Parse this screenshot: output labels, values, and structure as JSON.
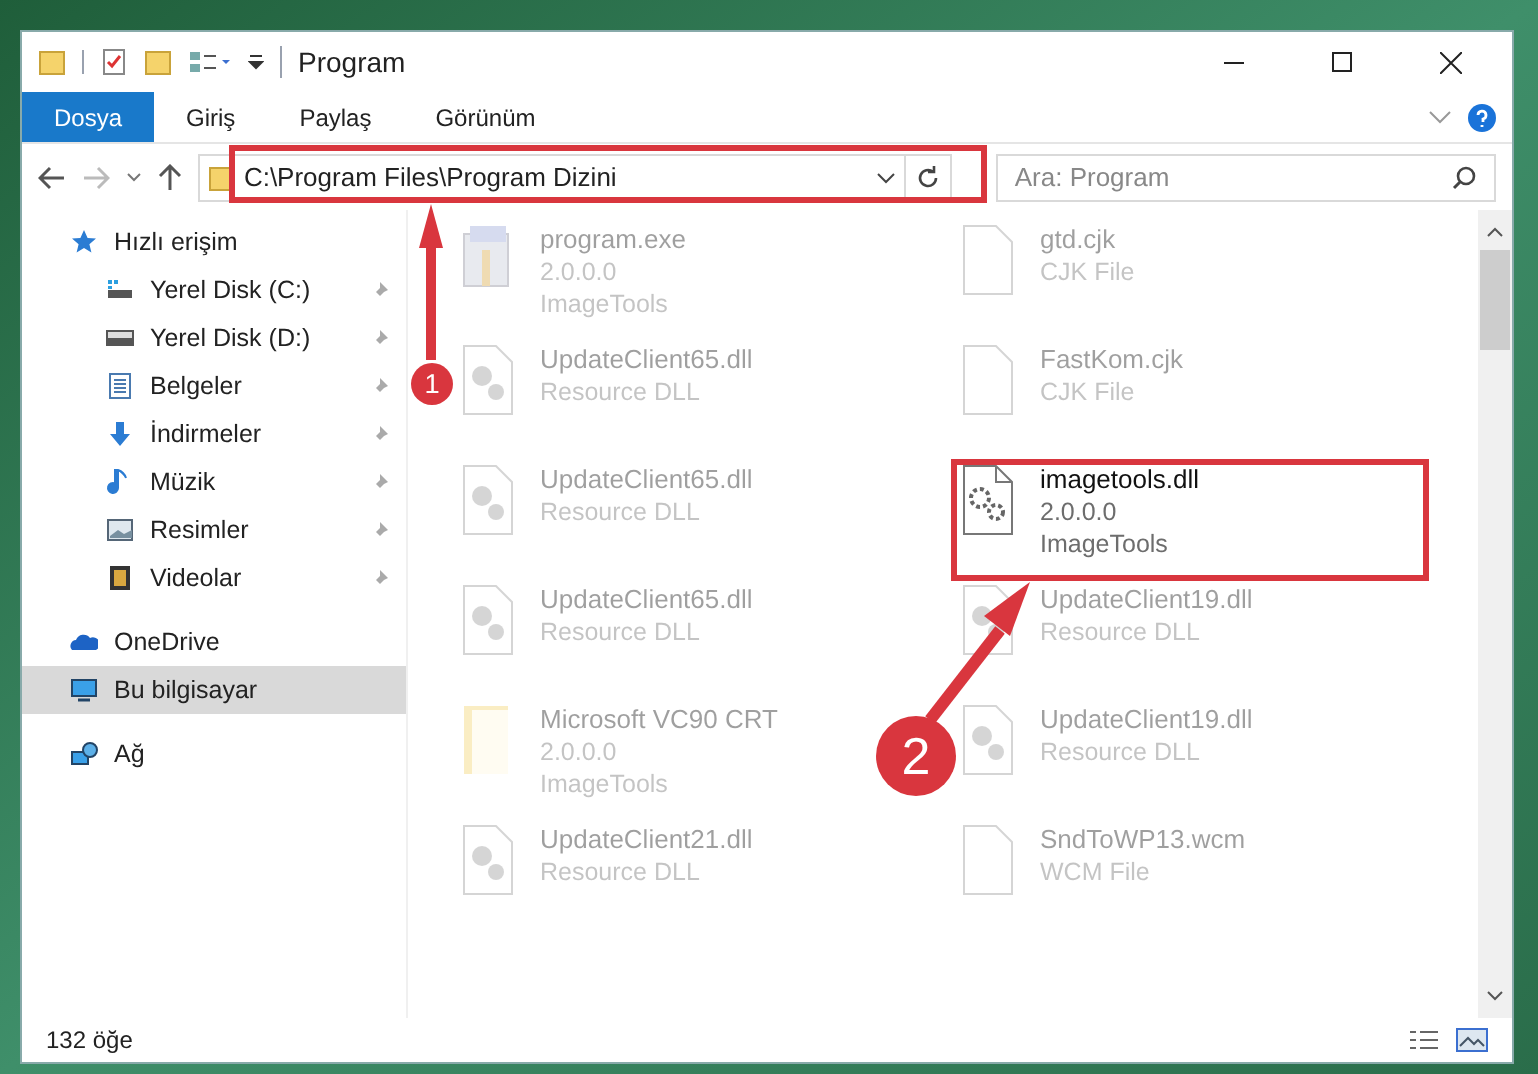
{
  "window": {
    "title": "Program"
  },
  "ribbon_tabs": [
    {
      "label": "Dosya",
      "selected": true
    },
    {
      "label": "Giriş",
      "selected": false
    },
    {
      "label": "Paylaş",
      "selected": false
    },
    {
      "label": "Görünüm",
      "selected": false
    }
  ],
  "address_bar": {
    "path": "C:\\Program Files\\Program Dizini"
  },
  "search": {
    "placeholder": "Ara: Program"
  },
  "sidebar": {
    "items": [
      {
        "label": "Hızlı erişim",
        "kind": "star",
        "selected": false,
        "children": [
          {
            "label": "Yerel Disk (C:)",
            "kind": "system-drive",
            "pinned": true,
            "selected": false
          },
          {
            "label": "Yerel Disk (D:)",
            "kind": "drive",
            "pinned": true,
            "selected": false
          },
          {
            "label": "Belgeler",
            "kind": "document",
            "pinned": true,
            "selected": false
          },
          {
            "label": "İndirmeler",
            "kind": "download",
            "pinned": true,
            "selected": false
          },
          {
            "label": "Müzik",
            "kind": "music",
            "pinned": true,
            "selected": false
          },
          {
            "label": "Resimler",
            "kind": "picture",
            "pinned": true,
            "selected": false
          },
          {
            "label": "Videolar",
            "kind": "video",
            "pinned": true,
            "selected": false
          }
        ]
      },
      {
        "label": "OneDrive",
        "kind": "cloud",
        "selected": false
      },
      {
        "label": "Bu bilgisayar",
        "kind": "computer",
        "selected": true
      },
      {
        "label": "Ağ",
        "kind": "network",
        "selected": false
      }
    ]
  },
  "files": [
    {
      "name": "program.exe",
      "details": [
        "2.0.0.0",
        "ImageTools"
      ],
      "kind": "exe",
      "faded": true
    },
    {
      "name": "gtd.cjk",
      "details": [
        "CJK File"
      ],
      "kind": "blank",
      "faded": true
    },
    {
      "name": "UpdateClient65.dll",
      "details": [
        "Resource DLL"
      ],
      "kind": "dll",
      "faded": true
    },
    {
      "name": "FastKom.cjk",
      "details": [
        "CJK File"
      ],
      "kind": "blank",
      "faded": true
    },
    {
      "name": "UpdateClient65.dll",
      "details": [
        "Resource DLL"
      ],
      "kind": "dll",
      "faded": true
    },
    {
      "name": "imagetools.dll",
      "details": [
        "2.0.0.0",
        "ImageTools"
      ],
      "kind": "gear",
      "faded": false
    },
    {
      "name": "UpdateClient65.dll",
      "details": [
        "Resource DLL"
      ],
      "kind": "dll",
      "faded": true
    },
    {
      "name": "UpdateClient19.dll",
      "details": [
        "Resource DLL"
      ],
      "kind": "dll",
      "faded": true
    },
    {
      "name": "Microsoft VC90 CRT",
      "details": [
        "2.0.0.0",
        "ImageTools"
      ],
      "kind": "folder",
      "faded": true
    },
    {
      "name": "UpdateClient19.dll",
      "details": [
        "Resource DLL"
      ],
      "kind": "dll",
      "faded": true
    },
    {
      "name": "UpdateClient21.dll",
      "details": [
        "Resource DLL"
      ],
      "kind": "dll",
      "faded": true
    },
    {
      "name": "SndToWP13.wcm",
      "details": [
        "WCM File"
      ],
      "kind": "blank",
      "faded": true
    }
  ],
  "status_bar": {
    "item_count": "132 öğe"
  },
  "annotations": [
    {
      "label": "1"
    },
    {
      "label": "2"
    }
  ]
}
